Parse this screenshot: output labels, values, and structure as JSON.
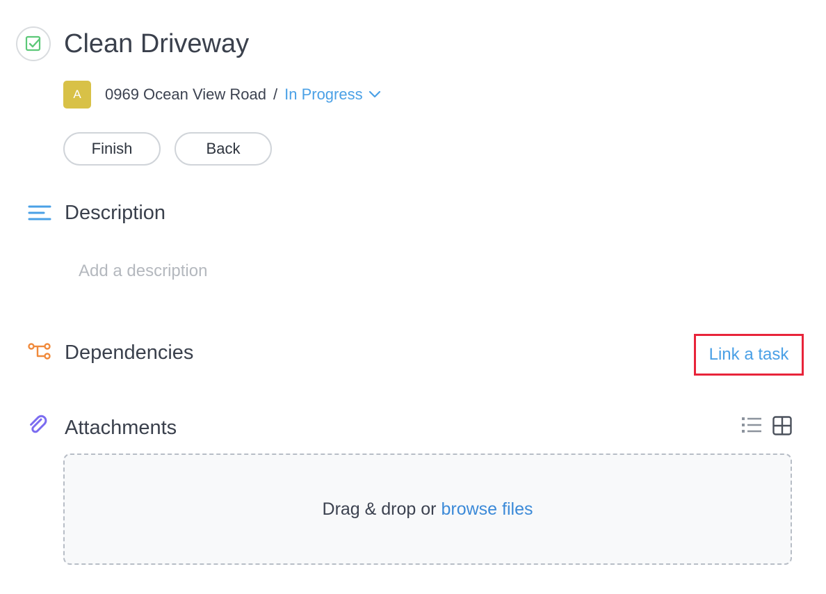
{
  "task": {
    "title": "Clean Driveway",
    "check_icon": "checkbox-check-icon"
  },
  "breadcrumb": {
    "avatar_initial": "A",
    "avatar_color": "#d8c147",
    "location": "0969 Ocean View Road",
    "separator": "/",
    "status": "In Progress",
    "status_icon": "chevron-down-icon"
  },
  "actions": {
    "finish_label": "Finish",
    "back_label": "Back"
  },
  "description": {
    "title": "Description",
    "icon": "align-left-icon",
    "placeholder": "Add a description"
  },
  "dependencies": {
    "title": "Dependencies",
    "icon": "dependency-tree-icon",
    "link_label": "Link a task"
  },
  "attachments": {
    "title": "Attachments",
    "icon": "paperclip-icon",
    "view_icons": [
      "list-view-icon",
      "grid-view-icon"
    ],
    "drop_text": "Drag & drop or",
    "browse_label": "browse files"
  },
  "colors": {
    "accent_blue": "#4aa0e6",
    "highlight_red": "#e8243a",
    "check_green": "#5cc878",
    "dependency_orange": "#f08a3c",
    "attachment_purple": "#7b6cf0"
  }
}
